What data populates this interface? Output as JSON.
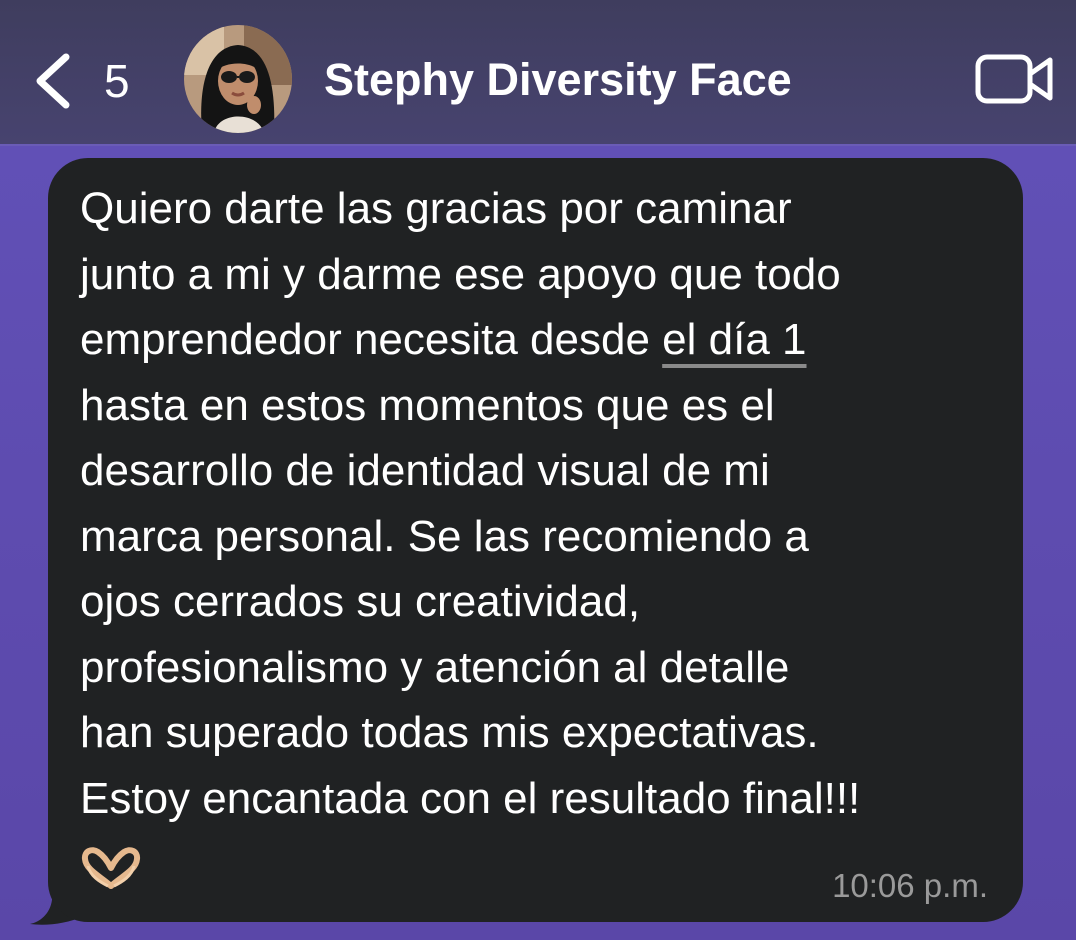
{
  "header": {
    "back_count": "5",
    "contact_name": "Stephy Diversity Face",
    "back_icon": "chevron-left-icon",
    "video_icon": "video-camera-icon"
  },
  "message": {
    "line_1": "Quiero darte las gracias por caminar",
    "line_2": "junto a mi y darme ese apoyo que todo",
    "line_3_start": "emprendedor necesita desde ",
    "line_3_link": "el día 1",
    "rest": "hasta en estos momentos que es el\ndesarrollo de identidad visual de mi\nmarca personal. Se las recomiendo a\nojos cerrados su creatividad,\nprofesionalismo y atención al detalle\nhan superado todas mis expectativas.\nEstoy encantada con el resultado final!!!",
    "emoji": "heart-hands-emoji",
    "timestamp": "10:06 p.m."
  },
  "colors": {
    "header_bg": "#44405f",
    "chat_bg": "#5d4aa7",
    "bubble_bg": "#202223",
    "text": "#ffffff",
    "timestamp": "#9a9a9a"
  }
}
